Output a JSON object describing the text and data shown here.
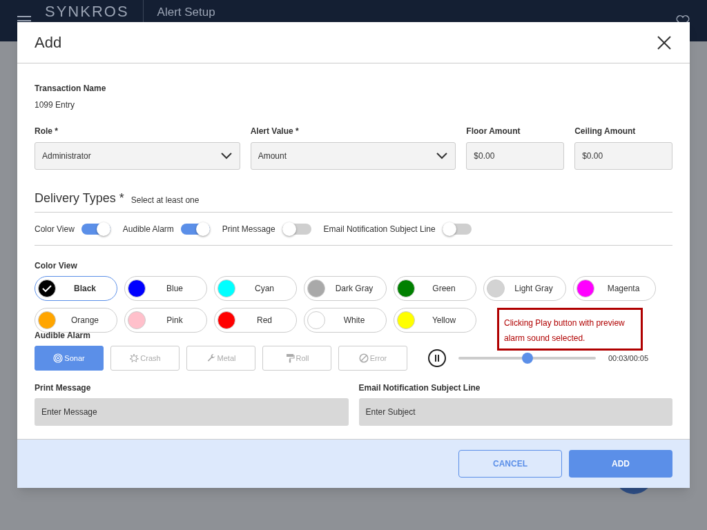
{
  "app_header": {
    "logo": "SYNKROS",
    "title": "Alert Setup"
  },
  "dialog": {
    "title": "Add",
    "transaction": {
      "label": "Transaction Name",
      "value": "1099 Entry"
    },
    "fields": [
      {
        "kind": "select",
        "label": "Role *",
        "value": "Administrator"
      },
      {
        "kind": "select",
        "label": "Alert Value *",
        "value": "Amount"
      },
      {
        "kind": "text",
        "label": "Floor Amount",
        "value": "$0.00"
      },
      {
        "kind": "text",
        "label": "Ceiling Amount",
        "value": "$0.00"
      }
    ],
    "delivery_types": {
      "title": "Delivery Types *",
      "hint": "Select at least one",
      "toggles": [
        {
          "label": "Color View",
          "on": true
        },
        {
          "label": "Audible Alarm",
          "on": true
        },
        {
          "label": "Print Message",
          "on": false
        },
        {
          "label": "Email Notification Subject Line",
          "on": false
        }
      ]
    },
    "color_view": {
      "label": "Color View",
      "colors": [
        {
          "name": "Black",
          "color": "#000000",
          "selected": true
        },
        {
          "name": "Blue",
          "color": "#0000ff",
          "selected": false
        },
        {
          "name": "Cyan",
          "color": "#00ffff",
          "selected": false
        },
        {
          "name": "Dark Gray",
          "color": "#a9a9a9",
          "selected": false
        },
        {
          "name": "Green",
          "color": "#008000",
          "selected": false
        },
        {
          "name": "Light Gray",
          "color": "#d3d3d3",
          "selected": false
        },
        {
          "name": "Magenta",
          "color": "#ff00ff",
          "selected": false
        },
        {
          "name": "Orange",
          "color": "#ffa500",
          "selected": false
        },
        {
          "name": "Pink",
          "color": "#ffc0cb",
          "selected": false
        },
        {
          "name": "Red",
          "color": "#ff0000",
          "selected": false
        },
        {
          "name": "White",
          "color": "#ffffff",
          "selected": false
        },
        {
          "name": "Yellow",
          "color": "#ffff00",
          "selected": false
        }
      ]
    },
    "note": "Clicking Play button with preview alarm sound selected.",
    "audible_alarm": {
      "label": "Audible Alarm",
      "sounds": [
        {
          "label": "Sonar",
          "selected": true
        },
        {
          "label": "Crash",
          "selected": false
        },
        {
          "label": "Metal",
          "selected": false
        },
        {
          "label": "Roll",
          "selected": false
        },
        {
          "label": "Error",
          "selected": false
        }
      ],
      "player": {
        "playing": true,
        "level": 0.5,
        "time": "00:03/00:05"
      }
    },
    "messages": [
      {
        "label": "Print Message",
        "placeholder": "Enter Message"
      },
      {
        "label": "Email Notification Subject Line",
        "placeholder": "Enter Subject"
      }
    ],
    "buttons": {
      "cancel": "CANCEL",
      "add": "ADD"
    }
  }
}
